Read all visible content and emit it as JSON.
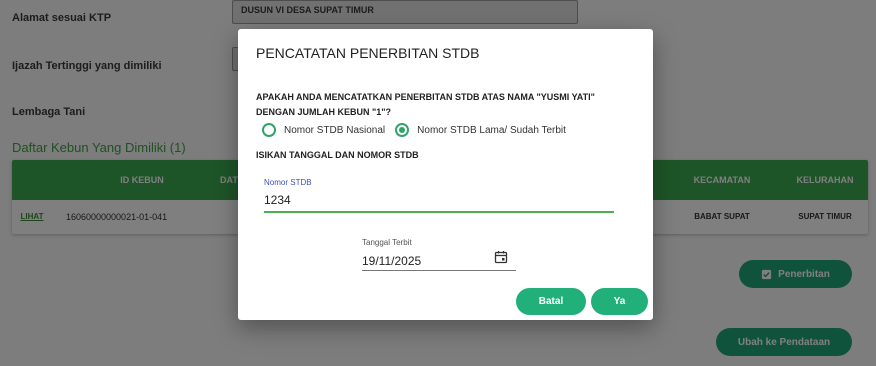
{
  "form": {
    "alamat_label": "Alamat sesuai KTP",
    "alamat_value": "DUSUN VI DESA SUPAT TIMUR",
    "ijazah_label": "Ijazah Tertinggi yang dimiliki",
    "lembaga_label": "Lembaga Tani"
  },
  "kebun": {
    "title": "Daftar Kebun Yang Dimiliki (1)",
    "headers": [
      "ID KEBUN",
      "DAT",
      "KECAMATAN",
      "KELURAHAN"
    ],
    "row": {
      "action": "LIHAT",
      "id": "16060000000021-01-041",
      "kecamatan": "BABAT SUPAT",
      "kelurahan": "SUPAT TIMUR"
    }
  },
  "buttons": {
    "penerbitan": "Penerbitan",
    "ubah": "Ubah ke Pendataan"
  },
  "dialog": {
    "title": "PENCATATAN PENERBITAN STDB",
    "question_line1": "APAKAH ANDA MENCATATKAN PENERBITAN STDB ATAS NAMA \"YUSMI YATI\"",
    "question_line2": "DENGAN JUMLAH KEBUN \"1\"?",
    "radio_options": [
      {
        "label": "Nomor STDB Nasional",
        "checked": false
      },
      {
        "label": "Nomor STDB Lama/ Sudah Terbit",
        "checked": true
      }
    ],
    "section_label": "ISIKAN TANGGAL DAN NOMOR STDB",
    "nomor_label": "Nomor STDB",
    "nomor_value": "1234",
    "tanggal_label": "Tanggal Terbit",
    "tanggal_value": "19/11/2025",
    "batal": "Batal",
    "ya": "Ya"
  },
  "colors": {
    "accent": "#21b07a",
    "header_green": "#3cab50",
    "title_green": "#43a047"
  },
  "icons": {
    "penerbitan": "checkbox-icon",
    "date": "calendar-icon"
  }
}
